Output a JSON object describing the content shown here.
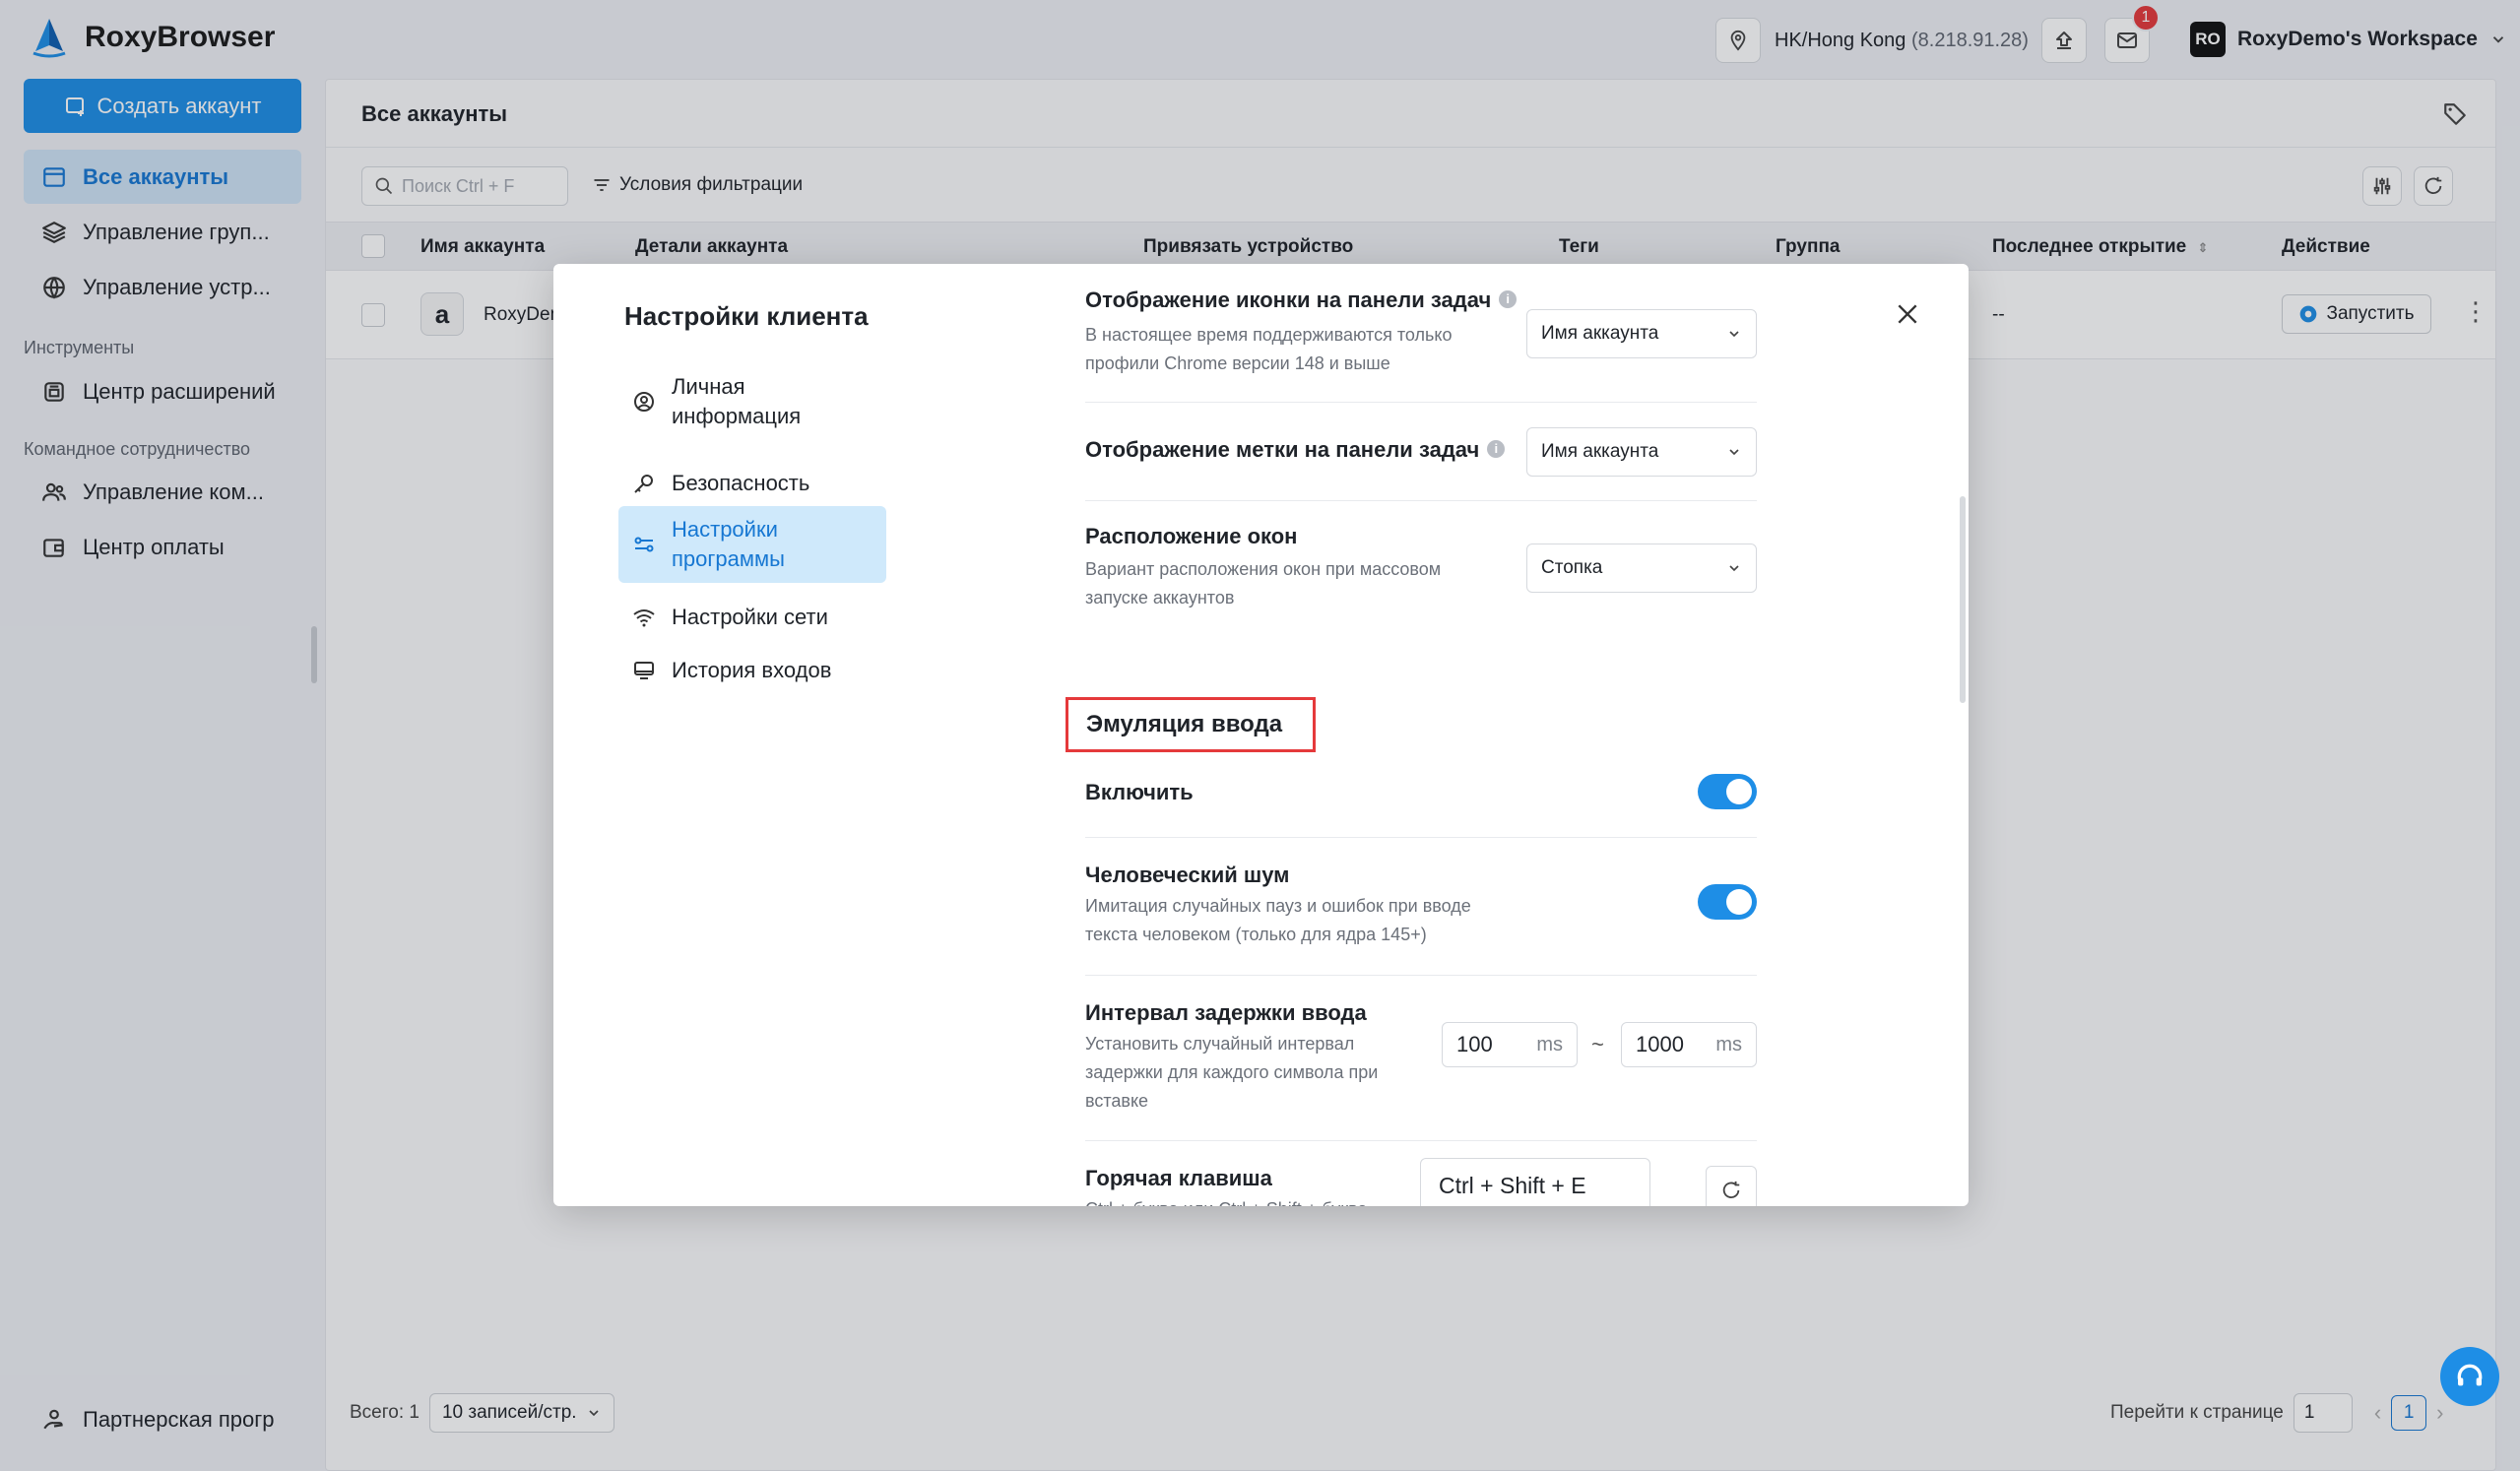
{
  "app": {
    "name": "RoxyBrowser"
  },
  "topbar": {
    "location": "HK/Hong Kong",
    "ip": "(8.218.91.28)",
    "mail_badge": "1",
    "workspace_avatar": "RO",
    "workspace_name": "RoxyDemo's Workspace"
  },
  "sidebar": {
    "create_button": "Создать аккаунт",
    "items": [
      {
        "label": "Все аккаунты",
        "icon": "window-icon"
      },
      {
        "label": "Управление груп...",
        "icon": "layers-icon"
      },
      {
        "label": "Управление устр...",
        "icon": "globe-icon"
      }
    ],
    "section_tools": "Инструменты",
    "tools_items": [
      {
        "label": "Центр расширений",
        "icon": "extension-icon"
      }
    ],
    "section_team": "Командное сотрудничество",
    "team_items": [
      {
        "label": "Управление ком...",
        "icon": "team-icon"
      },
      {
        "label": "Центр оплаты",
        "icon": "wallet-icon"
      }
    ],
    "partner": "Партнерская прогр"
  },
  "main": {
    "title": "Все аккаунты",
    "search_placeholder": "Поиск Ctrl + F",
    "filter_label": "Условия фильтрации",
    "columns": [
      "Имя аккаунта",
      "Детали аккаунта",
      "Привязать устройство",
      "Теги",
      "Группа",
      "Последнее открытие",
      "Действие"
    ],
    "row": {
      "name": "RoxyDem",
      "last_opened": "--",
      "launch": "Запустить"
    },
    "footer": {
      "total": "Всего: 1",
      "page_size": "10 записей/стр.",
      "goto_label": "Перейти к странице",
      "goto_value": "1",
      "current_page": "1"
    }
  },
  "modal": {
    "title": "Настройки клиента",
    "nav": [
      {
        "label": "Личная информация",
        "icon": "user-icon"
      },
      {
        "label": "Безопасность",
        "icon": "key-icon"
      },
      {
        "label": "Настройки программы",
        "icon": "sliders-icon",
        "active": true
      },
      {
        "label": "Настройки сети",
        "icon": "wifi-icon"
      },
      {
        "label": "История входов",
        "icon": "monitor-icon"
      }
    ],
    "settings": {
      "taskbar_icon": {
        "title": "Отображение иконки на панели задач",
        "desc": "В настоящее время поддерживаются только профили Chrome версии 148 и выше",
        "value": "Имя аккаунта"
      },
      "taskbar_label": {
        "title": "Отображение метки на панели задач",
        "value": "Имя аккаунта"
      },
      "window_layout": {
        "title": "Расположение окон",
        "desc": "Вариант расположения окон при массовом запуске аккаунтов",
        "value": "Стопка"
      }
    },
    "input_emulation": {
      "heading": "Эмуляция ввода",
      "enable": {
        "title": "Включить",
        "on": true
      },
      "human_noise": {
        "title": "Человеческий шум",
        "desc": "Имитация случайных пауз и ошибок при вводе текста человеком (только для ядра 145+)",
        "on": true
      },
      "delay": {
        "title": "Интервал задержки ввода",
        "desc": "Установить случайный интервал задержки для каждого символа при вставке",
        "min": "100",
        "max": "1000",
        "unit": "ms",
        "separator": "~"
      },
      "hotkey": {
        "title": "Горячая клавиша",
        "desc": "Ctrl + буква или Ctrl + Shift + буква",
        "value": "Ctrl + Shift + E"
      }
    }
  },
  "colors": {
    "accent": "#1e8ee6",
    "highlight": "#e5393b",
    "active_nav_bg": "#cfe3f6"
  }
}
